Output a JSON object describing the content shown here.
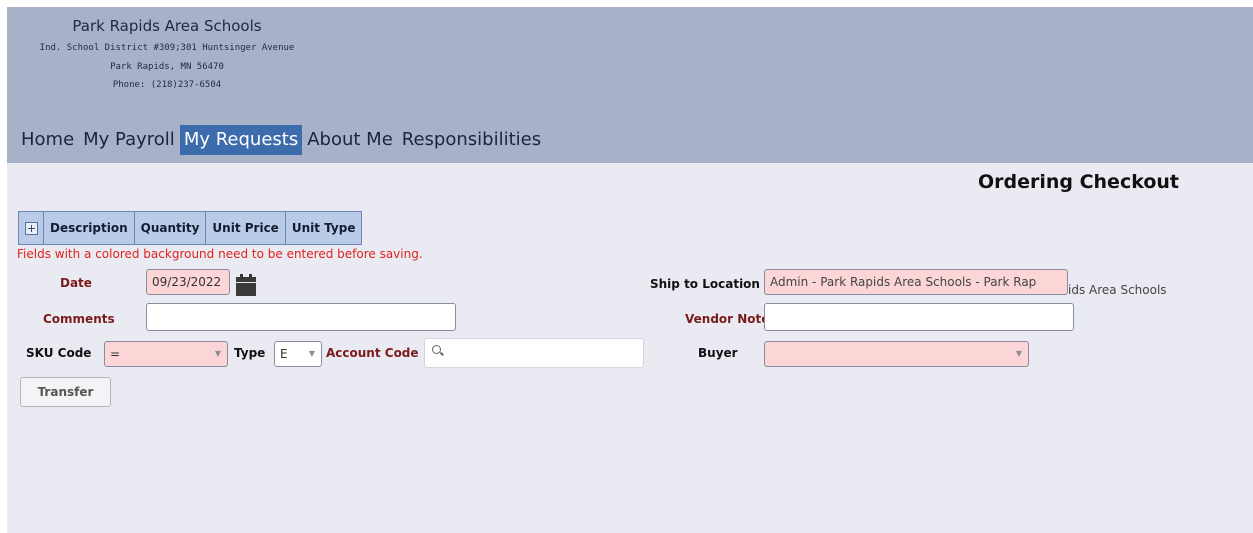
{
  "header": {
    "school_name": "Park Rapids Area Schools",
    "address_line1": "Ind. School District #309;301 Huntsinger Avenue",
    "address_line2": "Park Rapids, MN 56470",
    "address_line3": "Phone: (218)237-6504"
  },
  "nav": {
    "items": [
      "Home",
      "My Payroll",
      "My Requests",
      "About Me",
      "Responsibilities"
    ],
    "active": "My Requests"
  },
  "page_title": "Ordering Checkout",
  "grid": {
    "columns": [
      "Description",
      "Quantity",
      "Unit Price",
      "Unit Type"
    ]
  },
  "notice": "Fields with a colored background need to be entered before saving.",
  "form": {
    "date_label": "Date",
    "date_value": "09/23/2022",
    "comments_label": "Comments",
    "comments_value": "",
    "sku_label": "SKU Code",
    "sku_value": "=",
    "type_label": "Type",
    "type_value": "E",
    "account_label": "Account Code",
    "account_value": "",
    "ship_label": "Ship to Location",
    "ship_value_visible": "Admin - Park Rapids Area Schools - Park Rap",
    "ship_value_overflow": "ids Area Schools",
    "vendor_notes_label": "Vendor Notes",
    "vendor_notes_value": "",
    "buyer_label": "Buyer",
    "buyer_value": "",
    "transfer_button": "Transfer"
  },
  "colors": {
    "header_bg": "#a9b1c8",
    "active_tab": "#3c6cab",
    "required_field_bg": "#fcd6d6",
    "notice_red": "#e0231c"
  }
}
